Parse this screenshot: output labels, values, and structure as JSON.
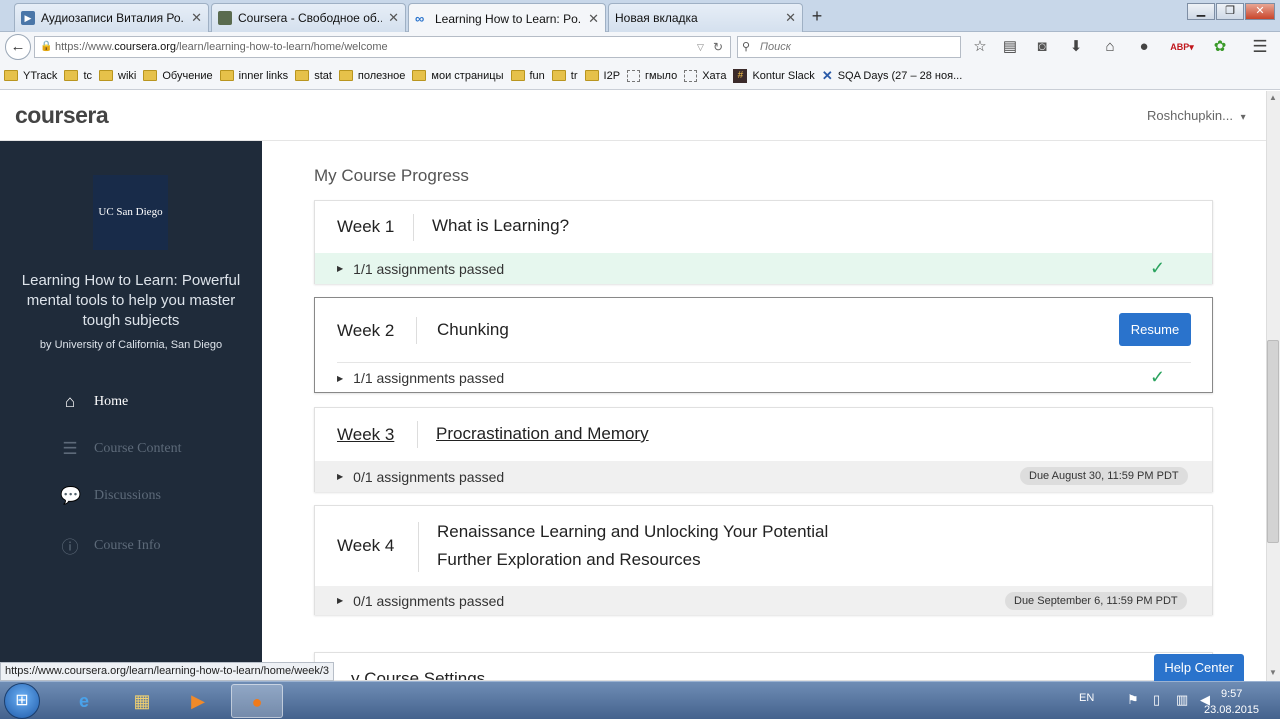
{
  "browser": {
    "tabs": [
      {
        "label": "Аудиозаписи Виталия Ро...",
        "icon": "vk-icon",
        "color": "#4a76a8"
      },
      {
        "label": "Coursera - Свободное об...",
        "icon": "coursera-icon",
        "color": "#5a6b4f"
      },
      {
        "label": "Learning How to Learn: Po...",
        "icon": "infinity-icon",
        "color": "#2a73cc"
      },
      {
        "label": "Новая вкладка",
        "icon": "",
        "color": ""
      }
    ],
    "url_prefix": "https://www.",
    "url_domain": "coursera.org",
    "url_path": "/learn/learning-how-to-learn/home/welcome",
    "search_placeholder": "Поиск",
    "bookmarks": [
      {
        "label": "YTrack",
        "kind": "folder"
      },
      {
        "label": "tc",
        "kind": "folder"
      },
      {
        "label": "wiki",
        "kind": "folder"
      },
      {
        "label": "Обучение",
        "kind": "folder"
      },
      {
        "label": "inner links",
        "kind": "folder"
      },
      {
        "label": "stat",
        "kind": "folder"
      },
      {
        "label": "полезное",
        "kind": "folder"
      },
      {
        "label": "мои страницы",
        "kind": "folder"
      },
      {
        "label": "fun",
        "kind": "folder"
      },
      {
        "label": "tr",
        "kind": "folder"
      },
      {
        "label": "I2P",
        "kind": "folder"
      },
      {
        "label": "гмыло",
        "kind": "dashed"
      },
      {
        "label": "Хата",
        "kind": "dashed"
      },
      {
        "label": "Kontur Slack",
        "kind": "slack"
      },
      {
        "label": "SQA Days (27 – 28 ноя...",
        "kind": "sqa"
      }
    ],
    "status_url": "https://www.coursera.org/learn/learning-how-to-learn/home/week/3"
  },
  "header": {
    "logo": "coursera",
    "user": "Roshchupkin...",
    "user_caret": "▾"
  },
  "sidebar": {
    "badge": "UC San Diego",
    "course_title": "Learning How to Learn: Powerful mental tools to help you master tough subjects",
    "course_by": "by University of California, San Diego",
    "nav": [
      {
        "label": "Home",
        "icon": "home-icon",
        "active": true
      },
      {
        "label": "Course Content",
        "icon": "list-icon",
        "active": false
      },
      {
        "label": "Discussions",
        "icon": "chat-icon",
        "active": false
      },
      {
        "label": "Course Info",
        "icon": "info-icon",
        "active": false
      }
    ]
  },
  "main": {
    "section_title": "My Course Progress",
    "weeks": [
      {
        "week": "Week 1",
        "titles": [
          "What is Learning?"
        ],
        "assignments": "1/1 assignments passed",
        "status": "passed",
        "due": ""
      },
      {
        "week": "Week 2",
        "titles": [
          "Chunking"
        ],
        "assignments": "1/1 assignments passed",
        "status": "passed",
        "due": "",
        "action": "Resume"
      },
      {
        "week": "Week 3",
        "titles": [
          "Procrastination and Memory"
        ],
        "assignments": "0/1 assignments passed",
        "status": "pending",
        "due": "Due August 30, 11:59 PM PDT"
      },
      {
        "week": "Week 4",
        "titles": [
          "Renaissance Learning and Unlocking Your Potential",
          "Further Exploration and Resources"
        ],
        "assignments": "0/1 assignments passed",
        "status": "pending",
        "due": "Due September 6, 11:59 PM PDT"
      }
    ],
    "settings_title_partial": "y Course Settings",
    "help_center": "Help Center"
  },
  "taskbar": {
    "lang": "EN",
    "time": "9:57",
    "date": "23.08.2015"
  },
  "colors": {
    "accent": "#2a73cc",
    "sidebar_bg": "#1f2b3a",
    "passed_bg": "#e6f7ee",
    "check": "#2aa35e"
  }
}
